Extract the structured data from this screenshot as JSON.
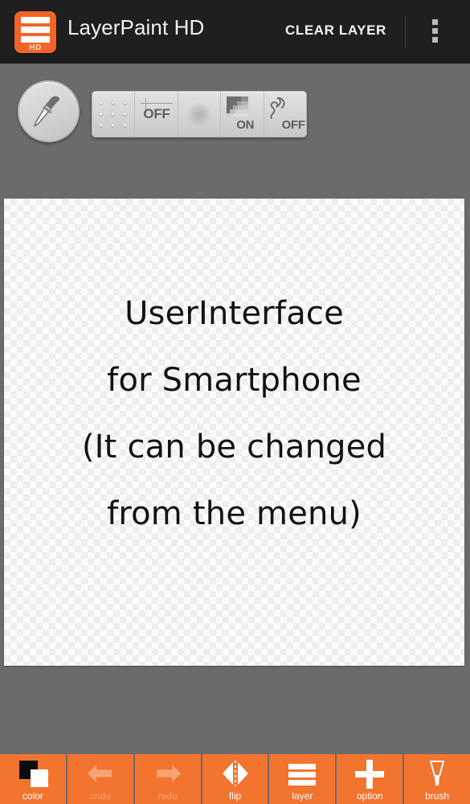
{
  "header": {
    "app_icon_label": "HD",
    "app_icon_name": "layers-icon",
    "title": "LayerPaint HD",
    "clear_layer_label": "CLEAR LAYER",
    "overflow_menu_name": "overflow-menu-icon",
    "background_color": "#1f1f1f",
    "accent_color": "#f2642a"
  },
  "toolbar": {
    "active_tool_icon": "eyedropper-icon",
    "buttons": [
      {
        "name": "grid-snap-button",
        "icon": "dot-grid-icon",
        "label": ""
      },
      {
        "name": "ruler-button",
        "icon": "ruler-line-icon",
        "label": "OFF"
      },
      {
        "name": "soft-brush-button",
        "icon": "soft-circle-icon",
        "label": ""
      },
      {
        "name": "pixel-shade-button",
        "icon": "pixel-gradient-icon",
        "label": "ON"
      },
      {
        "name": "stabilizer-button",
        "icon": "squiggle-curve-icon",
        "label": "OFF"
      }
    ]
  },
  "canvas": {
    "name": "drawing-canvas",
    "background": "transparent-checkerboard",
    "lines": [
      "UserInterface",
      "for Smartphone",
      "(It can be changed",
      " from the menu)"
    ]
  },
  "bottom_bar": {
    "accent_color": "#f2742f",
    "buttons": [
      {
        "name": "color-button",
        "label": "color",
        "icon": "color-swatch-icon",
        "enabled": true
      },
      {
        "name": "undo-button",
        "label": "undo",
        "icon": "arrow-left-icon",
        "enabled": false
      },
      {
        "name": "redo-button",
        "label": "redo",
        "icon": "arrow-right-icon",
        "enabled": false
      },
      {
        "name": "flip-button",
        "label": "flip",
        "icon": "flip-mirror-icon",
        "enabled": true
      },
      {
        "name": "layer-button",
        "label": "layer",
        "icon": "layer-stack-icon",
        "enabled": true
      },
      {
        "name": "option-button",
        "label": "option",
        "icon": "plus-icon",
        "enabled": true
      },
      {
        "name": "brush-button",
        "label": "brush",
        "icon": "brush-icon",
        "enabled": true
      }
    ]
  }
}
